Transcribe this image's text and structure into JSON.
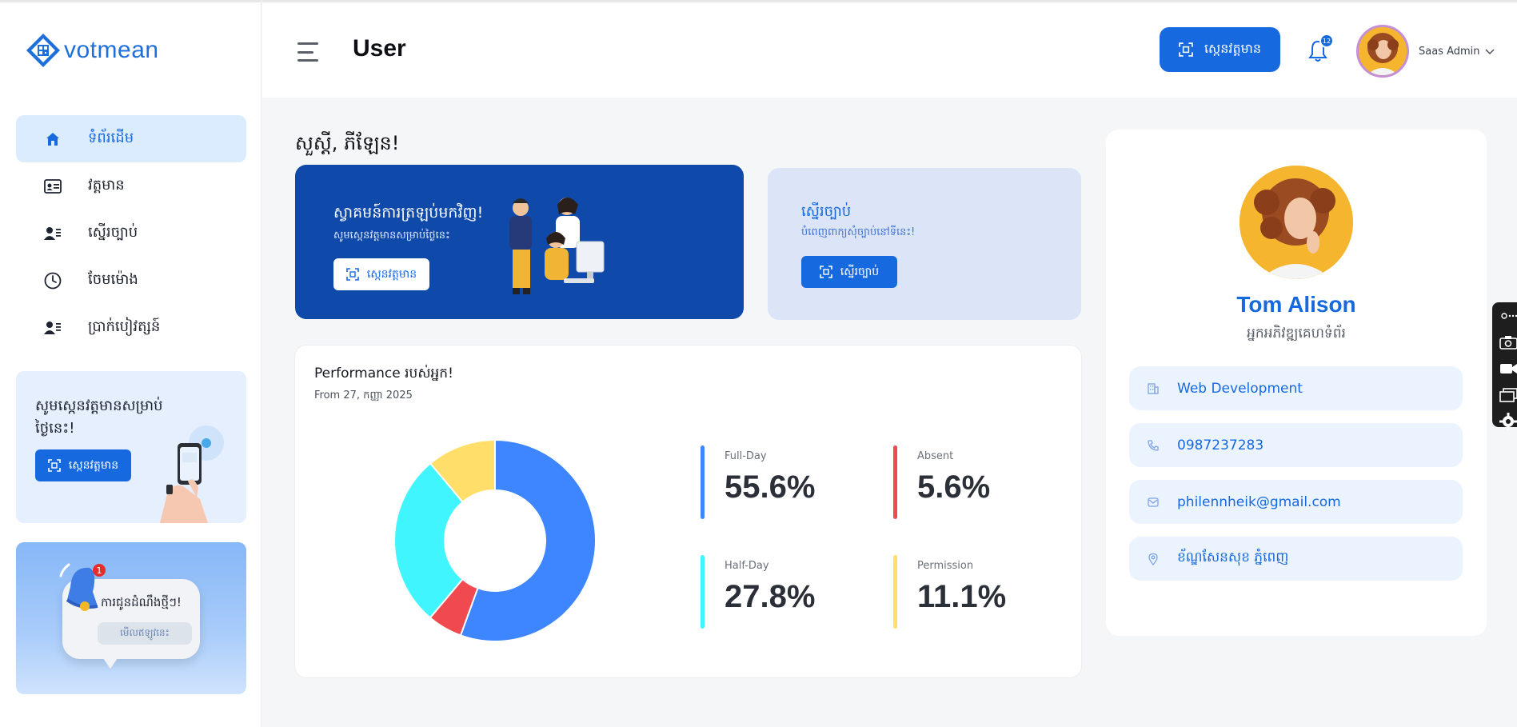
{
  "logo": {
    "text": "votmean"
  },
  "sidebar": {
    "items": [
      {
        "label": "ទំព័រដើម",
        "icon": "home-icon",
        "active": true
      },
      {
        "label": "វត្តមាន",
        "icon": "id-card-icon"
      },
      {
        "label": "ស្នើរច្បាប់",
        "icon": "user-list-icon"
      },
      {
        "label": "ចែមម៉ោង",
        "icon": "clock-icon"
      },
      {
        "label": "ប្រាក់បៀវត្សន៍",
        "icon": "user-list-icon"
      }
    ],
    "promo": {
      "title": "សូមស្កេនវត្តមានសម្រាប់ថ្ងៃនេះ!",
      "button": "ស្កេនវត្តមាន"
    },
    "notification_card": {
      "text": "ការជូនដំណឹងថ្មីៗ!",
      "link": "មើលឥឡូវនេះ",
      "badge": "1"
    }
  },
  "header": {
    "title": "User",
    "scan_button": "ស្កេនវត្តមាន",
    "notification_count": "12",
    "user_name": "Saas Admin"
  },
  "main": {
    "greeting": "សួស្តី, ភីឡែន!",
    "welcome": {
      "title": "ស្វាគមន៍ការត្រឡប់មកវិញ!",
      "subtitle": "សូមស្កេនវត្តមានសម្រាប់ថ្ងៃនេះ",
      "button": "ស្កេនវត្តមាន"
    },
    "permission": {
      "title": "ស្នើរច្បាប់",
      "subtitle": "បំពេញពាក្យសុំច្បាប់នៅទីនេះ!",
      "button": "ស្នើរច្បាប់"
    },
    "performance": {
      "title": "Performance របស់អ្នក!",
      "subtitle": "From 27, កញ្ញា 2025",
      "stats": [
        {
          "label": "Full-Day",
          "value": "55.6%",
          "color": "#3d86ff"
        },
        {
          "label": "Absent",
          "value": "5.6%",
          "color": "#f04a50"
        },
        {
          "label": "Half-Day",
          "value": "27.8%",
          "color": "#41f5ff"
        },
        {
          "label": "Permission",
          "value": "11.1%",
          "color": "#ffdf6a"
        }
      ]
    }
  },
  "chart_data": {
    "type": "pie",
    "categories": [
      "Full-Day",
      "Absent",
      "Half-Day",
      "Permission"
    ],
    "values": [
      55.6,
      5.6,
      27.8,
      11.1
    ],
    "colors": [
      "#3d86ff",
      "#f04a50",
      "#41f5ff",
      "#ffdf6a"
    ]
  },
  "profile": {
    "name": "Tom Alison",
    "role": "អ្នកអភិវឌ្ឍគេហទំព័រ",
    "fields": [
      {
        "value": "Web Development",
        "icon": "building-icon"
      },
      {
        "value": "0987237283",
        "icon": "phone-icon"
      },
      {
        "value": "philennheik@gmail.com",
        "icon": "mail-icon"
      },
      {
        "value": "ខ័ណ្ឌសែនសុខ ភ្នំពេញ",
        "icon": "location-icon"
      }
    ]
  }
}
